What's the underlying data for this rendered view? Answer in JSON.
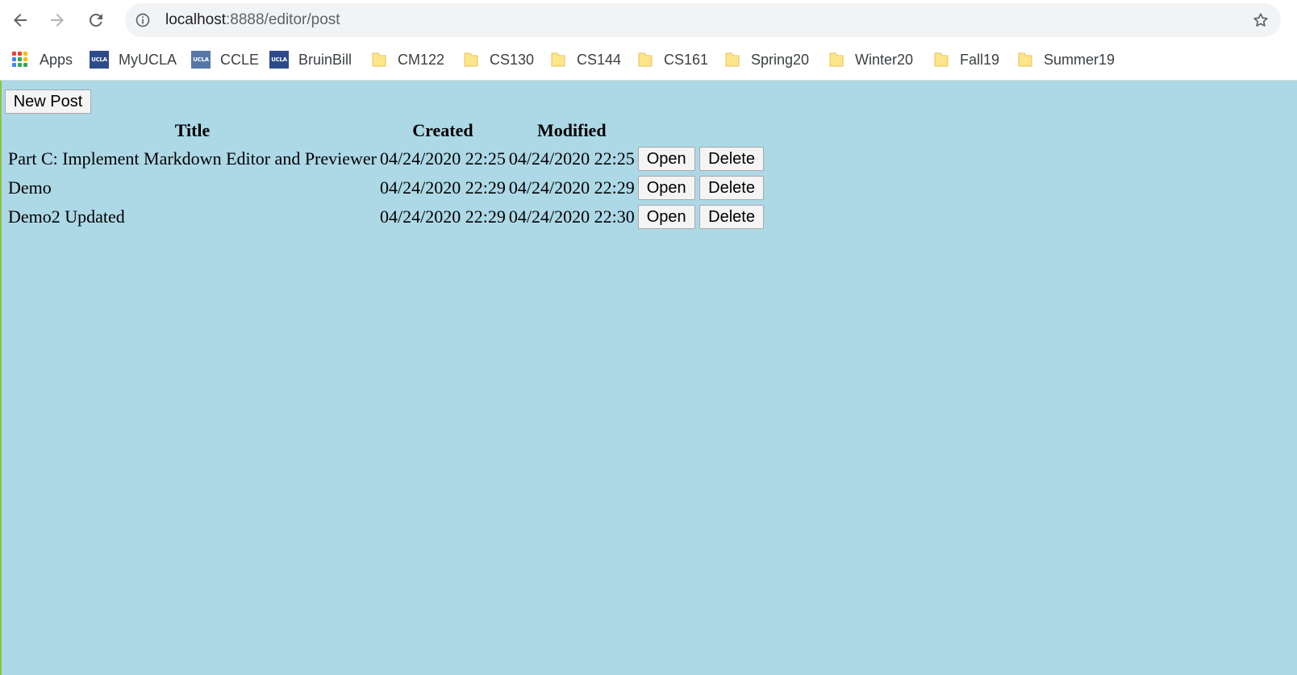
{
  "browser": {
    "url_host": "localhost",
    "url_path": ":8888/editor/post"
  },
  "bookmarks": [
    {
      "label": "Apps",
      "icon": "apps-grid-icon"
    },
    {
      "label": "MyUCLA",
      "icon": "ucla-icon"
    },
    {
      "label": "CCLE",
      "icon": "ucla-icon"
    },
    {
      "label": "BruinBill",
      "icon": "ucla-icon"
    },
    {
      "label": "CM122",
      "icon": "folder-icon"
    },
    {
      "label": "CS130",
      "icon": "folder-icon"
    },
    {
      "label": "CS144",
      "icon": "folder-icon"
    },
    {
      "label": "CS161",
      "icon": "folder-icon"
    },
    {
      "label": "Spring20",
      "icon": "folder-icon"
    },
    {
      "label": "Winter20",
      "icon": "folder-icon"
    },
    {
      "label": "Fall19",
      "icon": "folder-icon"
    },
    {
      "label": "Summer19",
      "icon": "folder-icon"
    }
  ],
  "ucla_badge": {
    "myucla": "UCLA",
    "ccle": "UCLA",
    "bruinbill": "UCLA"
  },
  "page": {
    "new_post_label": "New Post",
    "background": "#add8e6",
    "headers": {
      "title": "Title",
      "created": "Created",
      "modified": "Modified"
    },
    "posts": [
      {
        "title": "Part C: Implement Markdown Editor and Previewer",
        "created": "04/24/2020 22:25",
        "modified": "04/24/2020 22:25",
        "open": "Open",
        "delete": "Delete"
      },
      {
        "title": "Demo",
        "created": "04/24/2020 22:29",
        "modified": "04/24/2020 22:29",
        "open": "Open",
        "delete": "Delete"
      },
      {
        "title": "Demo2 Updated",
        "created": "04/24/2020 22:29",
        "modified": "04/24/2020 22:30",
        "open": "Open",
        "delete": "Delete"
      }
    ]
  }
}
